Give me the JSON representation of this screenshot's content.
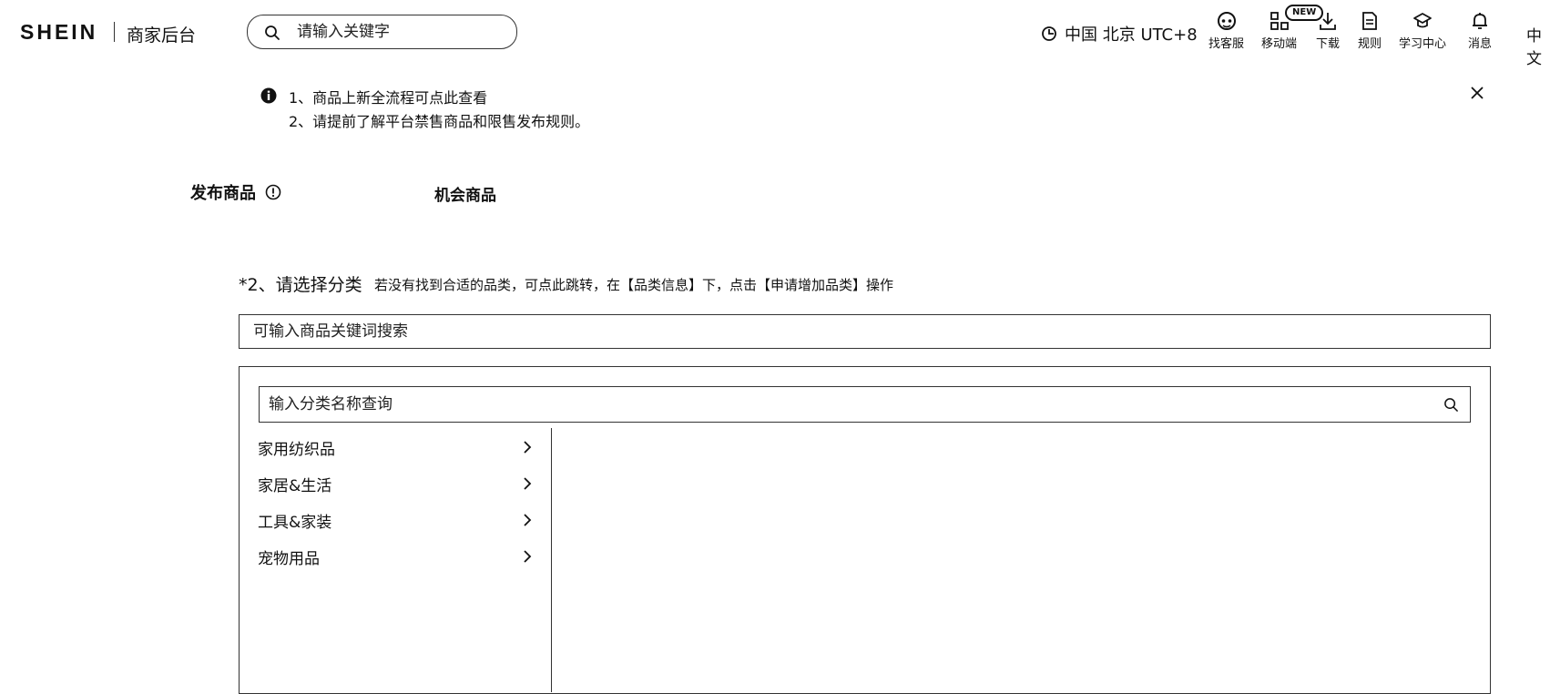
{
  "header": {
    "logo": "SHEIN",
    "subtitle": "商家后台",
    "search_placeholder": "请输入关键字",
    "timezone": "中国 北京 UTC+8",
    "nav": [
      {
        "label": "找客服",
        "icon": "customer-service-icon"
      },
      {
        "label": "移动端",
        "icon": "qr-code-icon",
        "badge": "NEW"
      },
      {
        "label": "下载",
        "icon": "download-icon"
      },
      {
        "label": "规则",
        "icon": "rules-document-icon"
      },
      {
        "label": "学习中心",
        "icon": "graduation-cap-icon"
      },
      {
        "label": "消息",
        "icon": "bell-icon"
      }
    ],
    "language": "中文"
  },
  "notice": {
    "line1": "1、商品上新全流程可点此查看",
    "line2": "2、请提前了解平台禁售商品和限售发布规则。"
  },
  "tabs": {
    "publish": "发布商品",
    "opportunity": "机会商品"
  },
  "step": {
    "title": "*2、请选择分类",
    "hint": "若没有找到合适的品类，可点此跳转，在【品类信息】下，点击【申请增加品类】操作",
    "keyword_placeholder": "可输入商品关键词搜索",
    "category_search_placeholder": "输入分类名称查询",
    "categories": [
      "家用纺织品",
      "家居&生活",
      "工具&家装",
      "宠物用品"
    ]
  }
}
